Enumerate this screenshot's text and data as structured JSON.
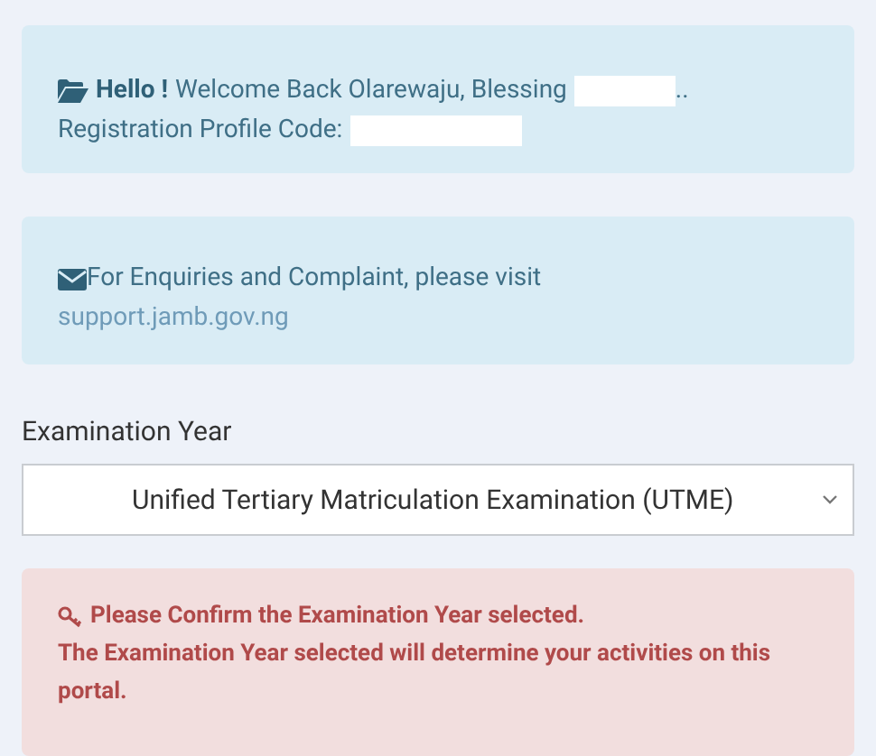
{
  "welcome_alert": {
    "greeting": "Hello !",
    "message": "Welcome Back Olarewaju, Blessing",
    "suffix": "..",
    "profile_code_label": "Registration Profile Code:"
  },
  "enquiries_alert": {
    "message": "For Enquiries and Complaint, please visit",
    "link": "support.jamb.gov.ng"
  },
  "examination_year": {
    "label": "Examination Year",
    "value": "Unified Tertiary Matriculation Examination (UTME)"
  },
  "warning_alert": {
    "title": "Please Confirm the Examination Year selected.",
    "message": "The Examination Year selected will determine your activities on this portal."
  }
}
